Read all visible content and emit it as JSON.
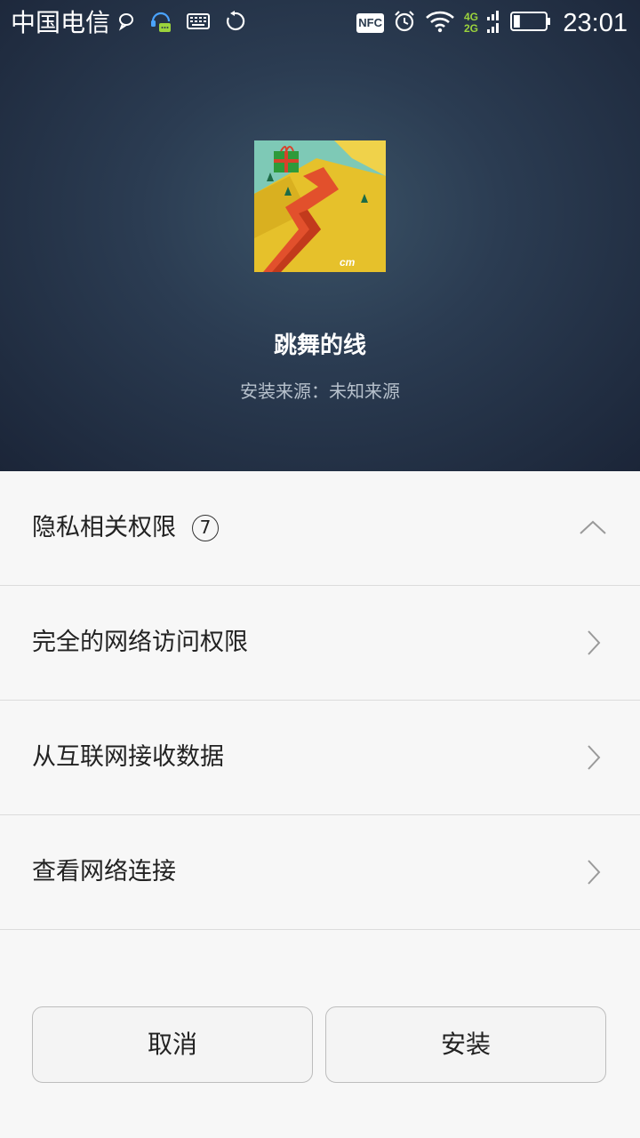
{
  "status_bar": {
    "carrier": "中国电信",
    "nfc_label": "NFC",
    "network_top": "4G",
    "network_bottom": "2G",
    "time": "23:01",
    "battery_level": 0.2
  },
  "app": {
    "name": "跳舞的线",
    "source": "安装来源：未知来源",
    "icon": "dancing-line-game-icon"
  },
  "permissions": {
    "header_label": "隐私相关权限",
    "count": "7",
    "items": [
      {
        "label": "完全的网络访问权限"
      },
      {
        "label": "从互联网接收数据"
      },
      {
        "label": "查看网络连接"
      }
    ]
  },
  "buttons": {
    "cancel": "取消",
    "install": "安装"
  },
  "colors": {
    "hero_bg": "#2b3c52",
    "page_bg": "#f7f7f7",
    "network_green": "#9bd33c"
  }
}
